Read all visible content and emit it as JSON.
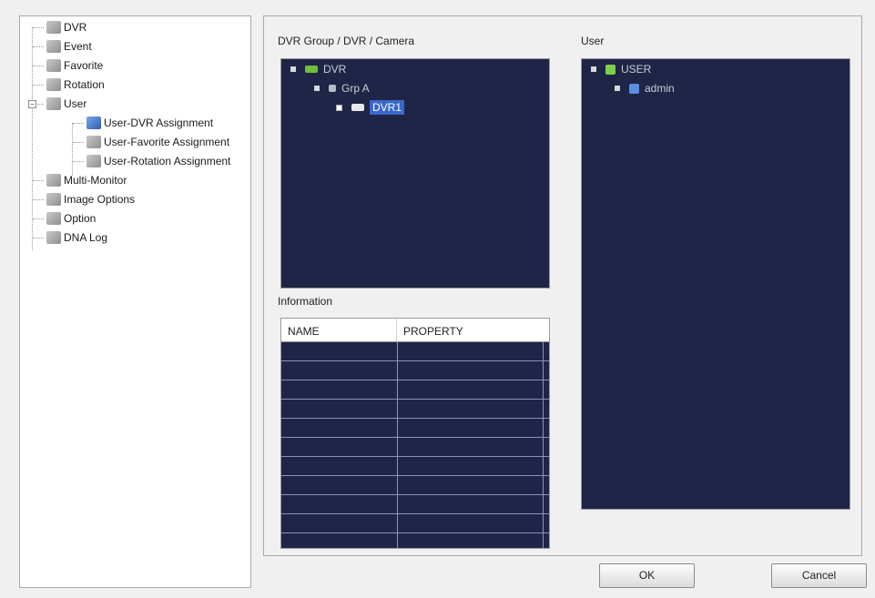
{
  "nav": {
    "items": [
      {
        "label": "DVR",
        "icon": "dvr-icon"
      },
      {
        "label": "Event",
        "icon": "event-icon"
      },
      {
        "label": "Favorite",
        "icon": "favorite-icon"
      },
      {
        "label": "Rotation",
        "icon": "rotation-icon"
      },
      {
        "label": "User",
        "icon": "user-icon"
      },
      {
        "label": "User-DVR Assignment",
        "icon": "user-dvr-assignment-icon"
      },
      {
        "label": "User-Favorite Assignment",
        "icon": "user-favorite-assignment-icon"
      },
      {
        "label": "User-Rotation Assignment",
        "icon": "user-rotation-assignment-icon"
      },
      {
        "label": "Multi-Monitor",
        "icon": "multi-monitor-icon"
      },
      {
        "label": "Image Options",
        "icon": "image-options-icon"
      },
      {
        "label": "Option",
        "icon": "option-icon"
      },
      {
        "label": "DNA Log",
        "icon": "dna-log-icon"
      }
    ]
  },
  "dvr_panel": {
    "title": "DVR Group / DVR / Camera",
    "tree": [
      {
        "label": "DVR"
      },
      {
        "label": "Grp A"
      },
      {
        "label": "DVR1"
      }
    ]
  },
  "user_panel": {
    "title": "User",
    "tree": [
      {
        "label": "USER"
      },
      {
        "label": "admin"
      }
    ]
  },
  "info": {
    "title": "Information",
    "columns": [
      "NAME",
      "PROPERTY"
    ]
  },
  "buttons": {
    "ok": "OK",
    "cancel": "Cancel"
  }
}
